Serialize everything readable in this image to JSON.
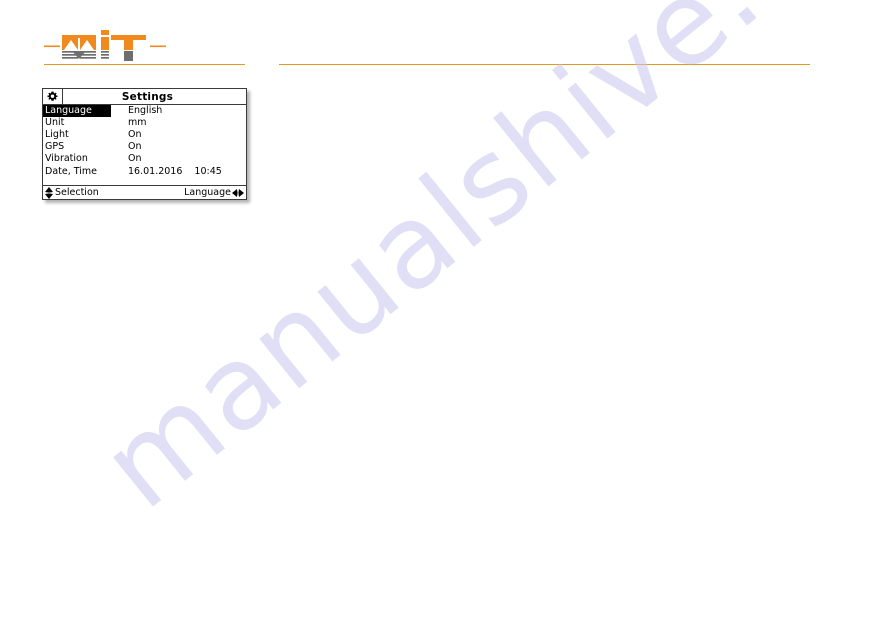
{
  "page": {
    "background_color": "#ffffff",
    "accent_color": "#e09a20"
  },
  "watermark": {
    "text": "manualshive.com",
    "color": "#c9c6ef"
  },
  "logo": {
    "name": "MIT",
    "primary_color": "#f08a1e",
    "secondary_color": "#6e6e6e"
  },
  "device_screen": {
    "titlebar": {
      "icon": "gear-icon",
      "title": "Settings"
    },
    "rows": [
      {
        "label": "Language",
        "value": "English",
        "value2": "",
        "selected": true
      },
      {
        "label": "Unit",
        "value": "mm",
        "value2": "",
        "selected": false
      },
      {
        "label": "Light",
        "value": "On",
        "value2": "",
        "selected": false
      },
      {
        "label": "GPS",
        "value": "On",
        "value2": "",
        "selected": false
      },
      {
        "label": "Vibration",
        "value": "On",
        "value2": "",
        "selected": false
      },
      {
        "label": "Date, Time",
        "value": "16.01.2016",
        "value2": "10:45",
        "selected": false
      }
    ],
    "statusbar": {
      "left_icon": "up-down-arrows-icon",
      "left_label": "Selection",
      "right_label": "Language",
      "right_icon": "left-right-arrows-icon"
    }
  }
}
